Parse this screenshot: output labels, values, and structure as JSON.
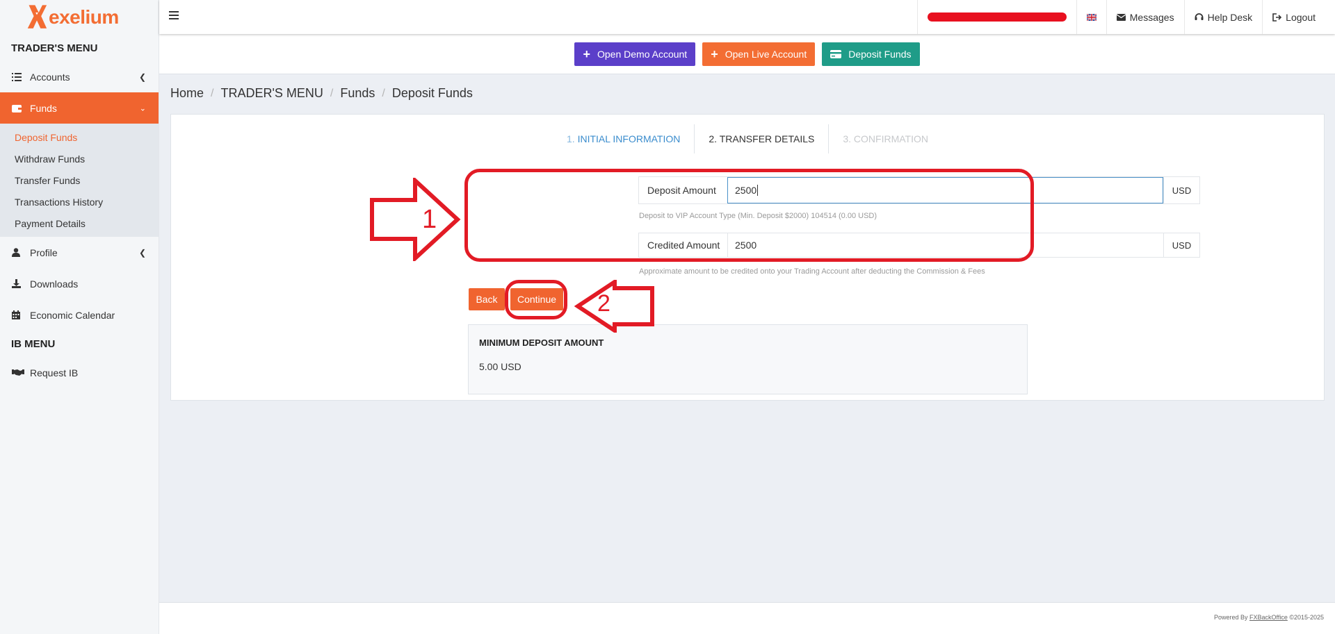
{
  "brand": {
    "name": "exelium",
    "accent": "#f36d33"
  },
  "sidebar": {
    "traders_heading": "TRADER'S MENU",
    "items": [
      {
        "label": "Accounts",
        "icon": "list-icon"
      },
      {
        "label": "Funds",
        "icon": "wallet-icon"
      }
    ],
    "funds_submenu": [
      {
        "label": "Deposit Funds"
      },
      {
        "label": "Withdraw Funds"
      },
      {
        "label": "Transfer Funds"
      },
      {
        "label": "Transactions History"
      },
      {
        "label": "Payment Details"
      }
    ],
    "items_after": [
      {
        "label": "Profile",
        "icon": "user-icon"
      },
      {
        "label": "Downloads",
        "icon": "download-icon"
      },
      {
        "label": "Economic Calendar",
        "icon": "calendar-icon"
      }
    ],
    "ib_heading": "IB MENU",
    "ib_items": [
      {
        "label": "Request IB",
        "icon": "handshake-icon"
      }
    ]
  },
  "topbar": {
    "messages": "Messages",
    "help_desk": "Help Desk",
    "logout": "Logout"
  },
  "actions": {
    "open_demo": "Open Demo Account",
    "open_live": "Open Live Account",
    "deposit_funds": "Deposit Funds"
  },
  "breadcrumb": [
    "Home",
    "TRADER'S MENU",
    "Funds",
    "Deposit Funds"
  ],
  "steps": {
    "s1_num": "1.",
    "s1_label": "INITIAL INFORMATION",
    "s2": "2. TRANSFER DETAILS",
    "s3": "3. CONFIRMATION"
  },
  "form": {
    "deposit_label": "Deposit Amount",
    "deposit_value": "2500",
    "deposit_unit": "USD",
    "deposit_help": "Deposit to VIP Account Type (Min. Deposit $2000) 104514 (0.00 USD)",
    "credited_label": "Credited Amount",
    "credited_value": "2500",
    "credited_unit": "USD",
    "credited_help": "Approximate amount to be credited onto your Trading Account after deducting the Commission & Fees",
    "back": "Back",
    "continue": "Continue"
  },
  "min_deposit": {
    "title": "MINIMUM DEPOSIT AMOUNT",
    "value": "5.00 USD"
  },
  "footer": {
    "powered_by": "Powered By ",
    "link": "FXBackOffice",
    "copyright": " ©2015-2025"
  },
  "annotations": {
    "arrow1_label": "1",
    "arrow2_label": "2",
    "color": "#e21b25"
  }
}
